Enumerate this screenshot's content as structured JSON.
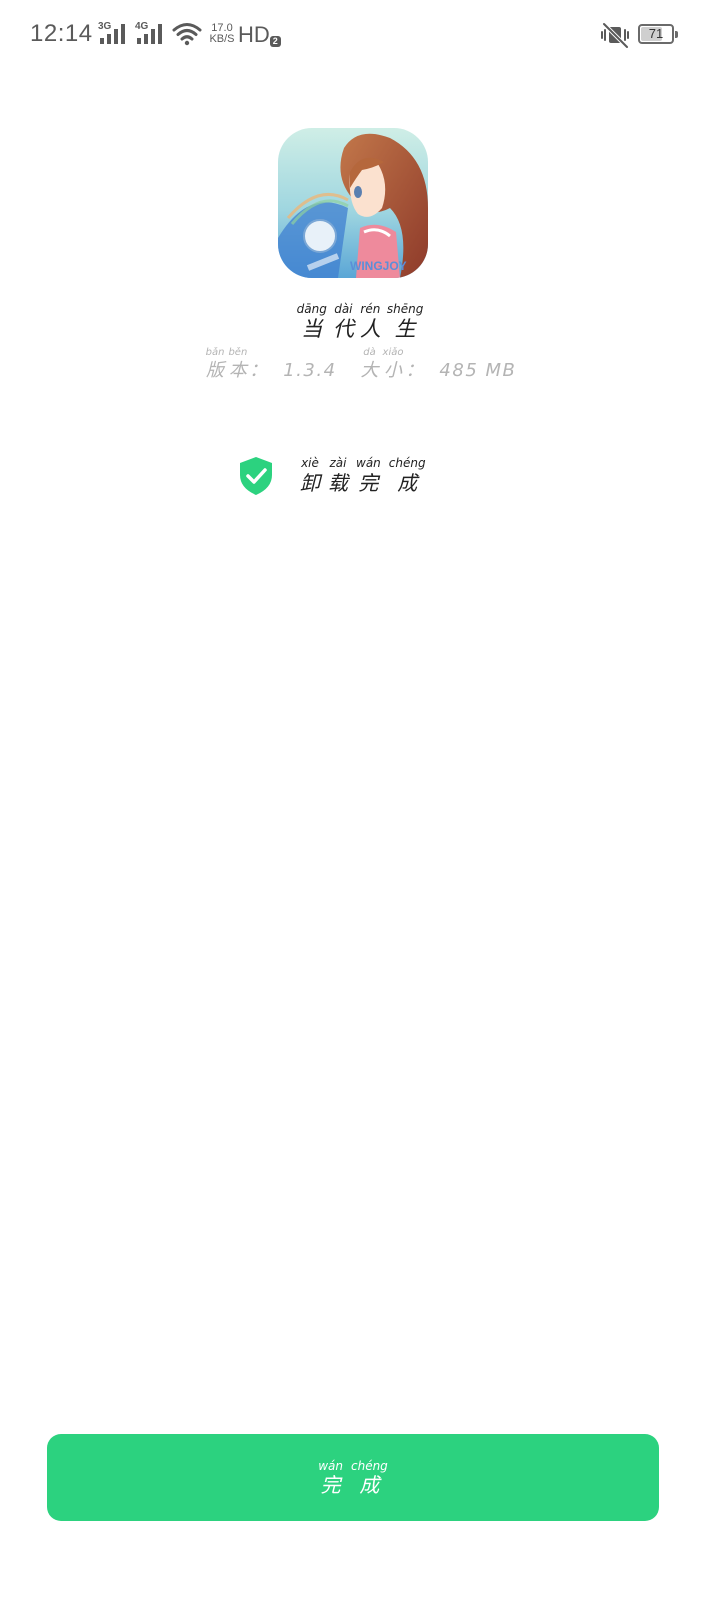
{
  "status_bar": {
    "time": "12:14",
    "signal_1": "3G",
    "signal_2": "4G",
    "speed_value": "17.0",
    "speed_unit": "KB/S",
    "hd": "HD",
    "hd_sub": "2",
    "battery_level": "71",
    "battery_fraction": 0.71,
    "icons": [
      "signal-icon",
      "wifi-icon",
      "vibrate-mute-icon",
      "battery-icon"
    ]
  },
  "app": {
    "icon": "app-icon-anime-girl",
    "icon_caption": "WINGJOY",
    "name": [
      {
        "py": "dāng",
        "hz": "当"
      },
      {
        "py": "dài",
        "hz": "代"
      },
      {
        "py": "rén",
        "hz": "人"
      },
      {
        "py": "shēng",
        "hz": "生"
      }
    ],
    "version_label": [
      {
        "py": "bǎn",
        "hz": "版"
      },
      {
        "py": "běn",
        "hz": "本"
      }
    ],
    "version_value": "：  1.3.4",
    "size_label": [
      {
        "py": "dà",
        "hz": "大"
      },
      {
        "py": "xiǎo",
        "hz": "小"
      }
    ],
    "size_value": "：  485 MB"
  },
  "result": {
    "icon": "shield-check-icon",
    "text": [
      {
        "py": "xiè",
        "hz": "卸"
      },
      {
        "py": "zài",
        "hz": "载"
      },
      {
        "py": "wán",
        "hz": "完"
      },
      {
        "py": "chéng",
        "hz": "成"
      }
    ]
  },
  "done_button": {
    "label": [
      {
        "py": "wán",
        "hz": "完"
      },
      {
        "py": "chéng",
        "hz": "成"
      }
    ]
  },
  "colors": {
    "accent": "#2cd27f",
    "text": "#222222",
    "muted": "#b4b4b4",
    "status": "#5a5a5a"
  }
}
